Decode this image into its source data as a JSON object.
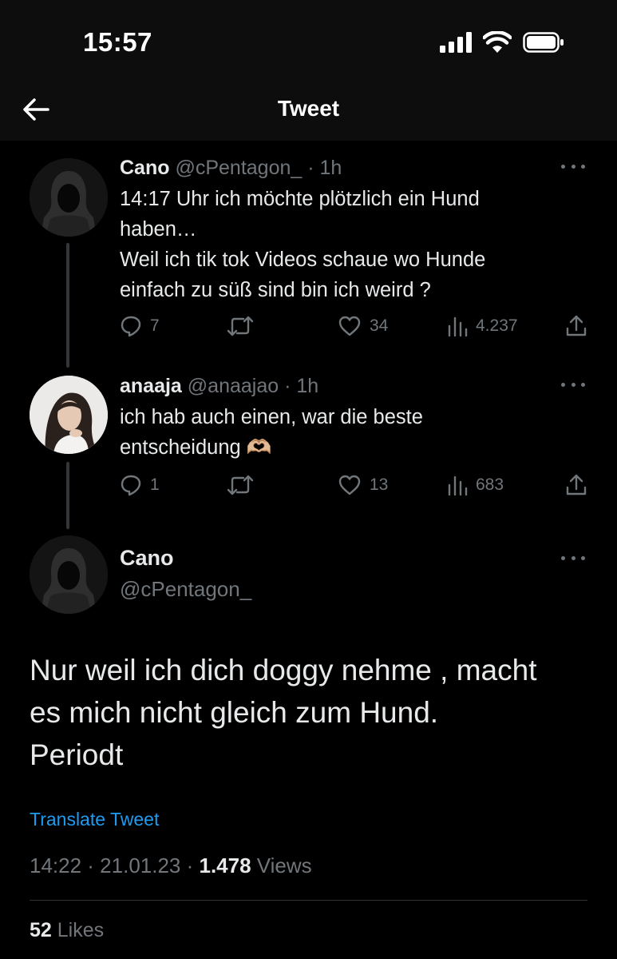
{
  "status_bar": {
    "time": "15:57",
    "icons": [
      "cellular-signal-icon",
      "wifi-icon",
      "battery-icon"
    ]
  },
  "header": {
    "title": "Tweet",
    "back_icon": "arrow-left-icon"
  },
  "thread": [
    {
      "name": "Cano",
      "handle": "@cPentagon_",
      "time_sep": " · 1h",
      "text_lines": [
        "14:17 Uhr ich möchte plötzlich ein Hund",
        "haben…",
        "Weil ich tik tok Videos schaue wo Hunde",
        "einfach zu süß sind bin ich weird ?"
      ],
      "replies": "7",
      "retweets": "",
      "likes": "34",
      "views": "4.237"
    },
    {
      "name": "anaaja",
      "handle": "@anaajao",
      "time_sep": " · 1h",
      "text_lines": [
        "ich hab auch einen, war die beste",
        "entscheidung 🫶🏼"
      ],
      "replies": "1",
      "retweets": "",
      "likes": "13",
      "views": "683"
    }
  ],
  "main_tweet": {
    "name": "Cano",
    "handle": "@cPentagon_",
    "text_lines": [
      "Nur weil ich dich doggy nehme , macht",
      "es mich nicht gleich zum Hund.",
      "Periodt"
    ],
    "translate_label": "Translate Tweet",
    "timestamp": "14:22 · 21.01.23 · ",
    "views_count": "1.478",
    "views_label": " Views",
    "likes_count": "52",
    "likes_label": " Likes"
  },
  "colors": {
    "background": "#000000",
    "link": "#1d9bf0",
    "muted": "#71767b",
    "text": "#e7e9ea"
  }
}
